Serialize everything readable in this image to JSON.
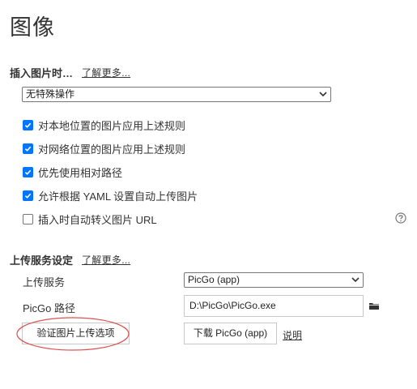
{
  "page": {
    "title": "图像"
  },
  "insert_section": {
    "heading": "插入图片时…",
    "learn_more": "了解更多..."
  },
  "insert_action_select": {
    "value": "无特殊操作"
  },
  "options": [
    {
      "label": "对本地位置的图片应用上述规则",
      "checked": true
    },
    {
      "label": "对网络位置的图片应用上述规则",
      "checked": true
    },
    {
      "label": "优先使用相对路径",
      "checked": true
    },
    {
      "label": "允许根据 YAML 设置自动上传图片",
      "checked": true
    },
    {
      "label": "插入时自动转义图片 URL",
      "checked": false
    }
  ],
  "upload_section": {
    "heading": "上传服务设定",
    "learn_more": "了解更多..."
  },
  "upload_service": {
    "label": "上传服务",
    "value": "PicGo (app)"
  },
  "picgo_path": {
    "label": "PicGo 路径",
    "value": "D:\\PicGo\\PicGo.exe"
  },
  "buttons": {
    "verify": "验证图片上传选项",
    "download": "下载 PicGo (app)",
    "explain": "说明"
  },
  "colors": {
    "accent": "#0075ff",
    "annotation": "#d9534f"
  }
}
